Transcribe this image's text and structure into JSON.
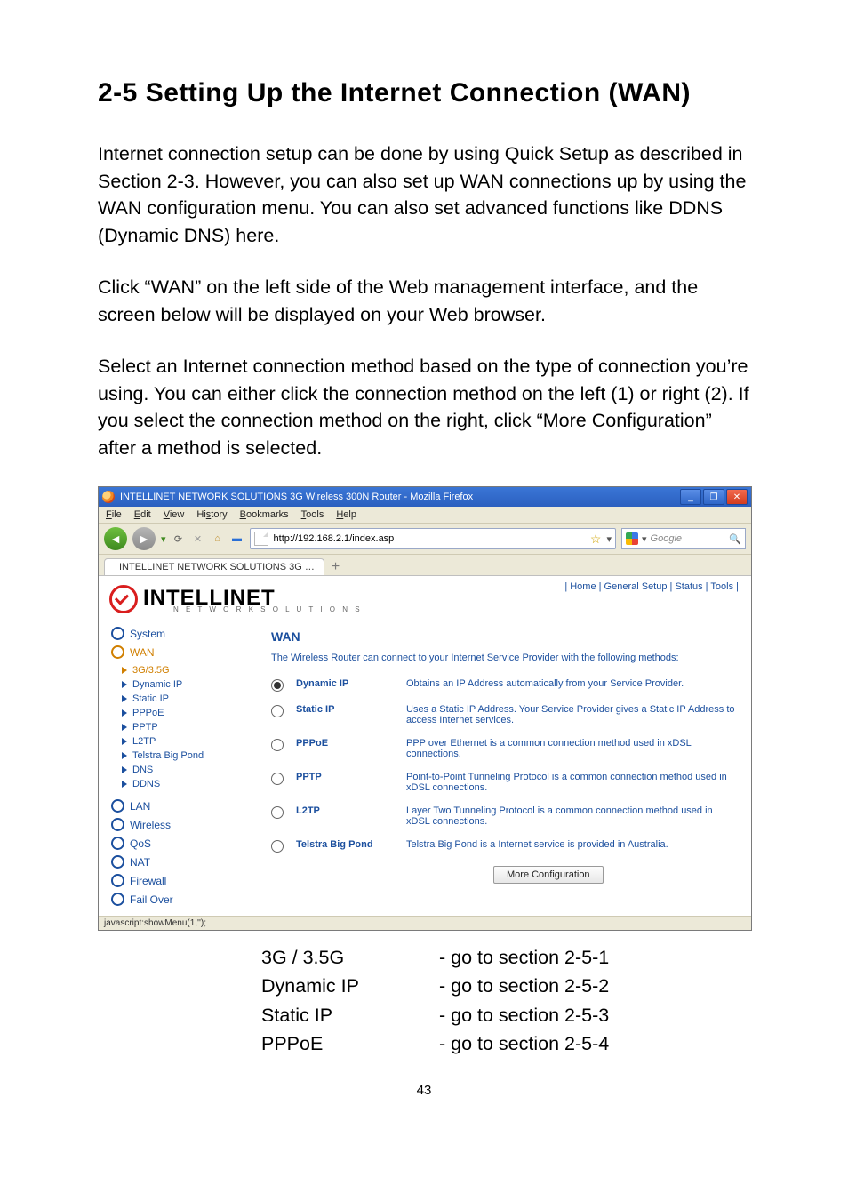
{
  "heading": "2-5 Setting Up the Internet Connection (WAN)",
  "paragraphs": {
    "p1": "Internet connection setup can be done by using Quick Setup as described in Section 2-3. However, you can also set up WAN connections up by using the WAN configuration menu. You can also set advanced functions like DDNS (Dynamic DNS) here.",
    "p2": "Click “WAN” on the left side of the Web management interface, and the screen below will be displayed on your Web browser.",
    "p3": "Select an Internet connection method based on the type of connection you’re using. You can either click the connection method on the left (1) or right (2). If you select the connection method on the right, click “More Configuration” after a method is selected."
  },
  "browser": {
    "title": "INTELLINET NETWORK SOLUTIONS 3G Wireless 300N Router - Mozilla Firefox",
    "menus": {
      "file": "File",
      "edit": "Edit",
      "view": "View",
      "history": "History",
      "bookmarks": "Bookmarks",
      "tools": "Tools",
      "help": "Help"
    },
    "address": "http://192.168.2.1/index.asp",
    "search_placeholder": "Google",
    "tab_label": "INTELLINET NETWORK SOLUTIONS 3G …",
    "top_links": "| Home | General Setup | Status | Tools |",
    "brand_main": "INTELLINET",
    "brand_sub": "N E T W O R K   S O L U T I O N S",
    "status_bar": "javascript:showMenu(1,'');"
  },
  "sidebar": {
    "items": [
      {
        "label": "System",
        "type": "top"
      },
      {
        "label": "WAN",
        "type": "top",
        "selected": true
      },
      {
        "label": "3G/3.5G",
        "type": "sub",
        "selected": true
      },
      {
        "label": "Dynamic IP",
        "type": "sub"
      },
      {
        "label": "Static IP",
        "type": "sub"
      },
      {
        "label": "PPPoE",
        "type": "sub"
      },
      {
        "label": "PPTP",
        "type": "sub"
      },
      {
        "label": "L2TP",
        "type": "sub"
      },
      {
        "label": "Telstra Big Pond",
        "type": "sub"
      },
      {
        "label": "DNS",
        "type": "sub"
      },
      {
        "label": "DDNS",
        "type": "sub"
      },
      {
        "label": "LAN",
        "type": "top"
      },
      {
        "label": "Wireless",
        "type": "top"
      },
      {
        "label": "QoS",
        "type": "top"
      },
      {
        "label": "NAT",
        "type": "top"
      },
      {
        "label": "Firewall",
        "type": "top"
      },
      {
        "label": "Fail Over",
        "type": "top"
      }
    ]
  },
  "wan_panel": {
    "title": "WAN",
    "intro": "The Wireless Router can connect to your Internet Service Provider with the following methods:",
    "options": [
      {
        "name": "Dynamic IP",
        "desc": "Obtains an IP Address automatically from your Service Provider.",
        "selected": true
      },
      {
        "name": "Static IP",
        "desc": "Uses a Static IP Address. Your Service Provider gives a Static IP Address to access Internet services."
      },
      {
        "name": "PPPoE",
        "desc": "PPP over Ethernet is a common connection method used in xDSL connections."
      },
      {
        "name": "PPTP",
        "desc": "Point-to-Point Tunneling Protocol is a common connection method used in xDSL connections."
      },
      {
        "name": "L2TP",
        "desc": "Layer Two Tunneling Protocol is a common connection method used in xDSL connections."
      },
      {
        "name": "Telstra Big Pond",
        "desc": "Telstra Big Pond is a Internet service is provided in Australia."
      }
    ],
    "more_btn": "More Configuration"
  },
  "ref_table": [
    {
      "name": "3G / 3.5G",
      "goto": "- go to section 2-5-1"
    },
    {
      "name": "Dynamic IP",
      "goto": "- go to section 2-5-2"
    },
    {
      "name": "Static IP",
      "goto": "- go to section 2-5-3"
    },
    {
      "name": "PPPoE",
      "goto": "- go to section 2-5-4"
    }
  ],
  "page_number": "43"
}
